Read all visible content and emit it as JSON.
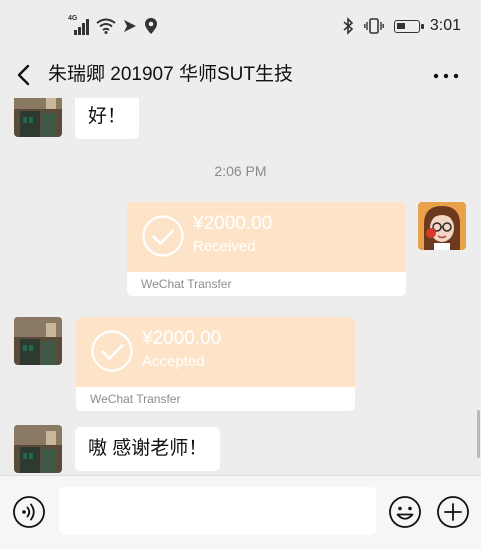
{
  "status_bar": {
    "network_tag": "4G",
    "time": "3:01",
    "icons": [
      "signal-icon",
      "wifi-icon",
      "data-arrow-icon",
      "location-icon",
      "bluetooth-icon",
      "vibrate-icon",
      "battery-icon"
    ]
  },
  "header": {
    "title": "朱瑞卿 201907 华师SUT生技"
  },
  "messages": [
    {
      "type": "text",
      "side": "left",
      "text": "好！"
    },
    {
      "type": "timestamp",
      "text": "2:06 PM"
    },
    {
      "type": "transfer",
      "side": "right",
      "amount": "¥2000.00",
      "status": "Received",
      "footer": "WeChat Transfer"
    },
    {
      "type": "transfer",
      "side": "left",
      "amount": "¥2000.00",
      "status": "Accepted",
      "footer": "WeChat Transfer"
    },
    {
      "type": "text",
      "side": "left",
      "text": "嗷 感谢老师！"
    }
  ],
  "colors": {
    "background": "#ededed",
    "transfer_card": "#fde4c8",
    "bubble": "#ffffff"
  },
  "input_bar": {
    "value": "",
    "placeholder": ""
  }
}
